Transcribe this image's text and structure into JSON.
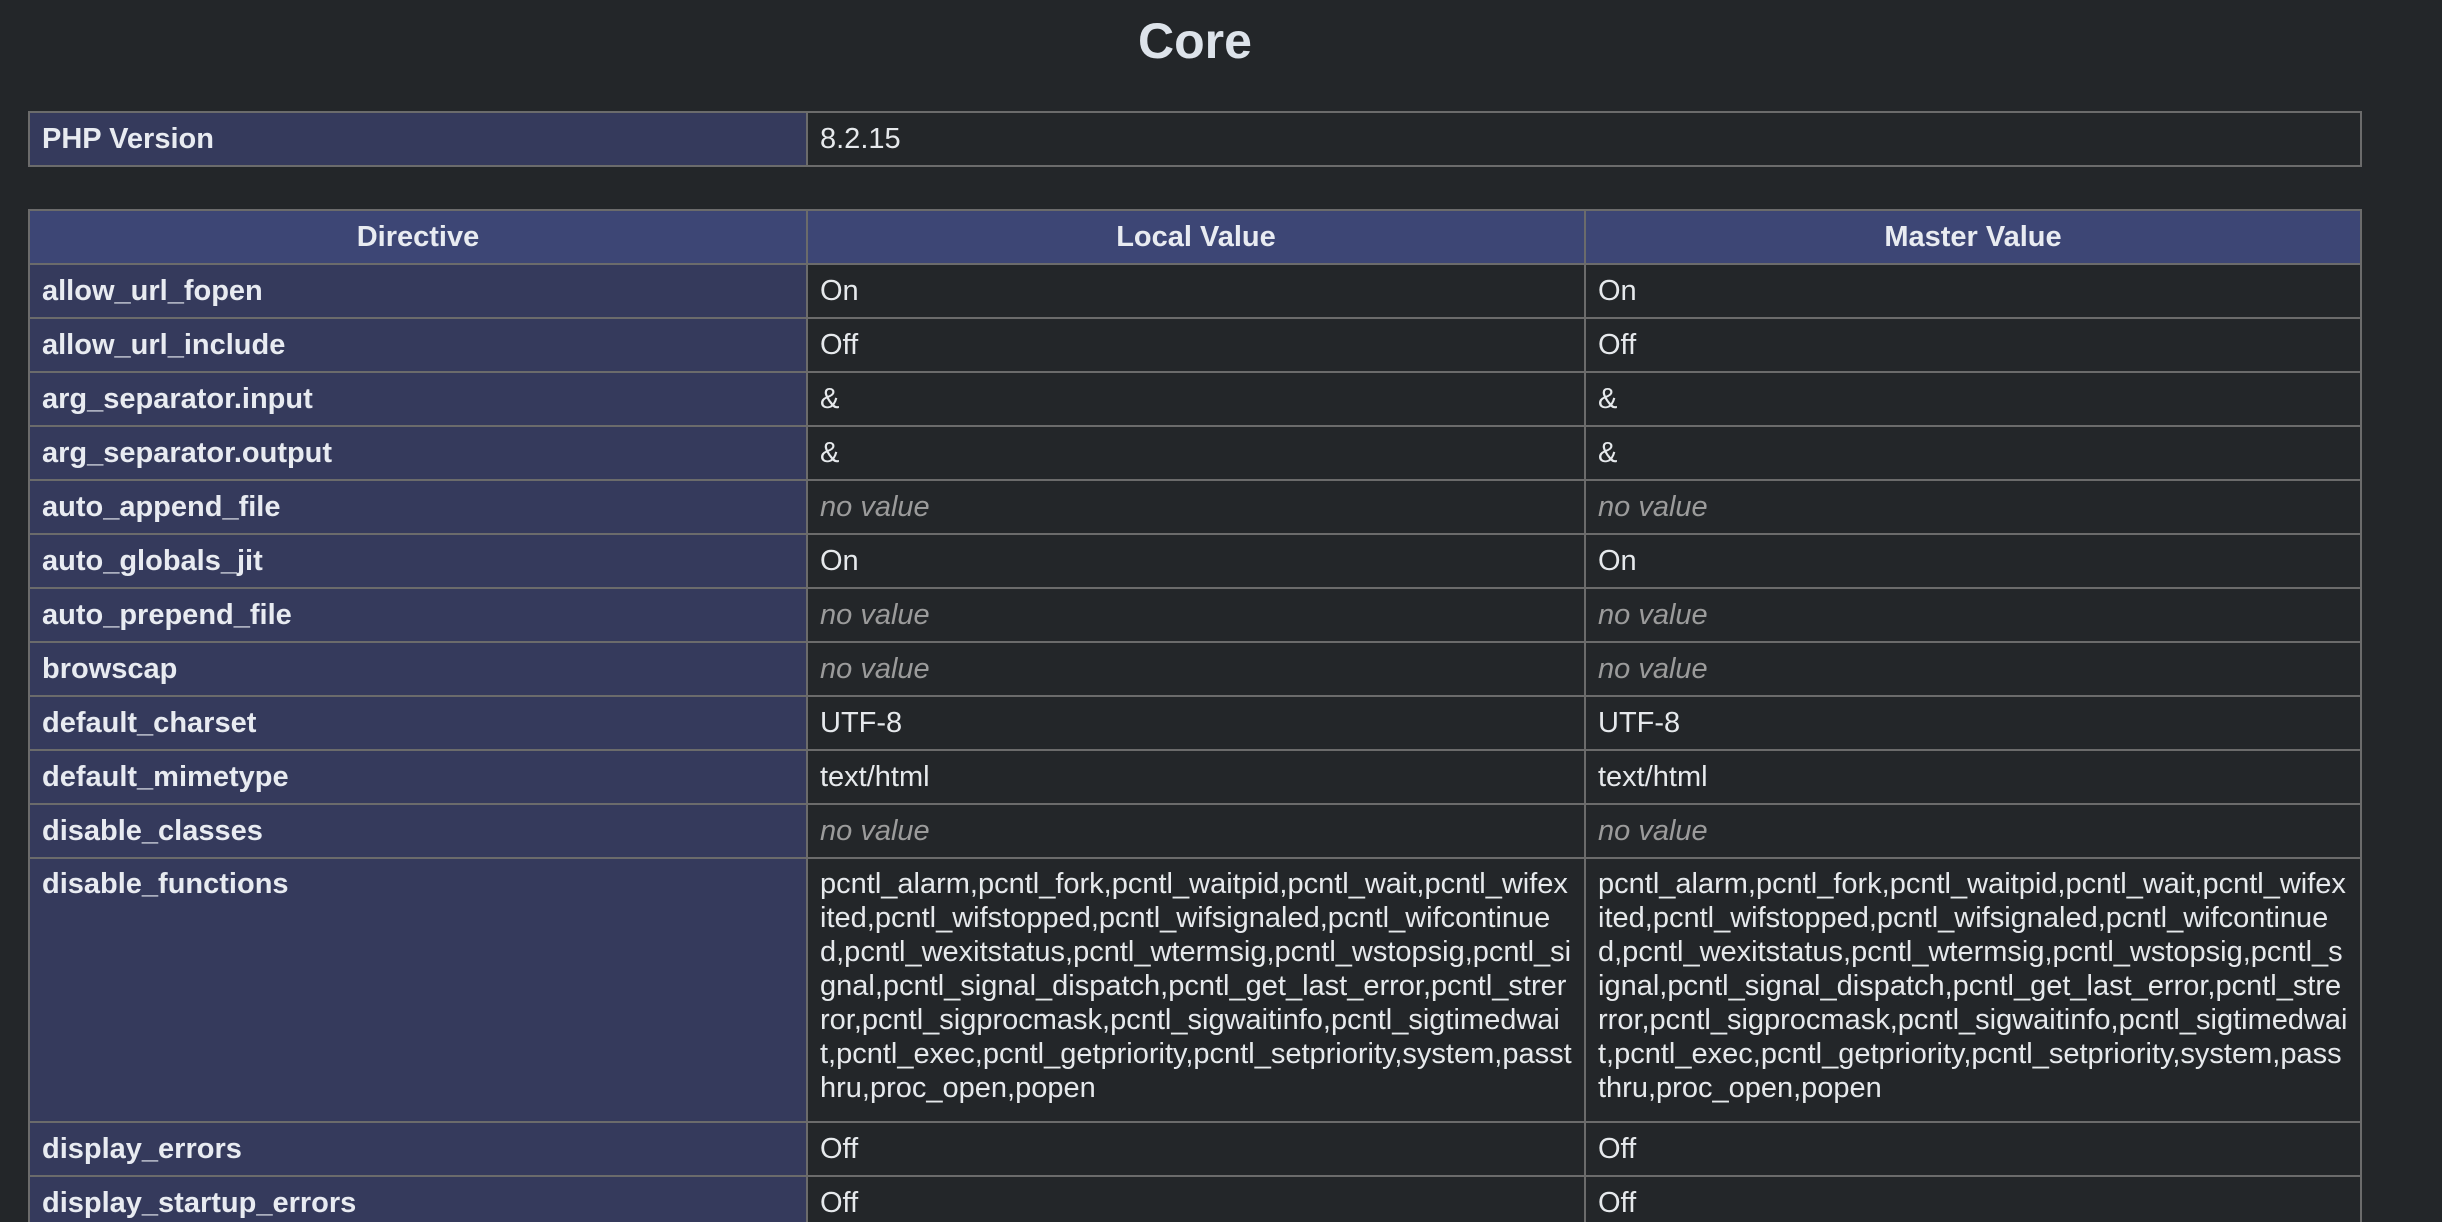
{
  "section_title": "Core",
  "php_version": {
    "label": "PHP Version",
    "value": "8.2.15"
  },
  "table": {
    "headers": [
      "Directive",
      "Local Value",
      "Master Value"
    ],
    "rows": [
      {
        "directive": "allow_url_fopen",
        "local": "On",
        "master": "On"
      },
      {
        "directive": "allow_url_include",
        "local": "Off",
        "master": "Off"
      },
      {
        "directive": "arg_separator.input",
        "local": "&",
        "master": "&"
      },
      {
        "directive": "arg_separator.output",
        "local": "&",
        "master": "&"
      },
      {
        "directive": "auto_append_file",
        "local": "no value",
        "master": "no value"
      },
      {
        "directive": "auto_globals_jit",
        "local": "On",
        "master": "On"
      },
      {
        "directive": "auto_prepend_file",
        "local": "no value",
        "master": "no value"
      },
      {
        "directive": "browscap",
        "local": "no value",
        "master": "no value"
      },
      {
        "directive": "default_charset",
        "local": "UTF-8",
        "master": "UTF-8"
      },
      {
        "directive": "default_mimetype",
        "local": "text/html",
        "master": "text/html"
      },
      {
        "directive": "disable_classes",
        "local": "no value",
        "master": "no value"
      },
      {
        "directive": "disable_functions",
        "local": "pcntl_alarm,pcntl_fork,pcntl_waitpid,pcntl_wait,pcntl_wifexited,pcntl_wifstopped,pcntl_wifsignaled,pcntl_wifcontinued,pcntl_wexitstatus,pcntl_wtermsig,pcntl_wstopsig,pcntl_signal,pcntl_signal_dispatch,pcntl_get_last_error,pcntl_strerror,pcntl_sigprocmask,pcntl_sigwaitinfo,pcntl_sigtimedwait,pcntl_exec,pcntl_getpriority,pcntl_setpriority,system,passthru,proc_open,popen",
        "master": "pcntl_alarm,pcntl_fork,pcntl_waitpid,pcntl_wait,pcntl_wifexited,pcntl_wifstopped,pcntl_wifsignaled,pcntl_wifcontinued,pcntl_wexitstatus,pcntl_wtermsig,pcntl_wstopsig,pcntl_signal,pcntl_signal_dispatch,pcntl_get_last_error,pcntl_strerror,pcntl_sigprocmask,pcntl_sigwaitinfo,pcntl_sigtimedwait,pcntl_exec,pcntl_getpriority,pcntl_setpriority,system,passthru,proc_open,popen"
      },
      {
        "directive": "display_errors",
        "local": "Off",
        "master": "Off"
      },
      {
        "directive": "display_startup_errors",
        "local": "Off",
        "master": "Off"
      }
    ]
  },
  "colors": {
    "background": "#232629",
    "directive_cell": "#353a5c",
    "header_cell": "#3d4675",
    "no_value_text": "#9b9b9b"
  }
}
